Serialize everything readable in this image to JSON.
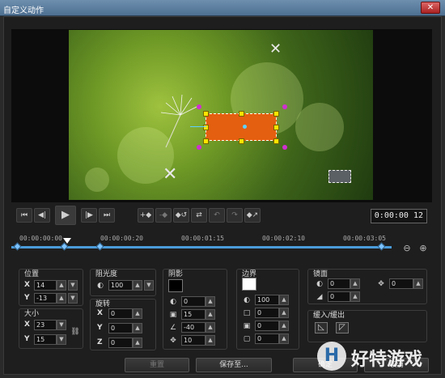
{
  "window": {
    "title": "自定义动作",
    "close_glyph": "✕"
  },
  "preview": {
    "cross_glyph": "✕",
    "icons": [
      "close-icon",
      "dandelion-icon"
    ]
  },
  "controls": {
    "buttons": [
      {
        "name": "go-start-button",
        "glyph": "⏮"
      },
      {
        "name": "prev-frame-button",
        "glyph": "◀|"
      },
      {
        "name": "play-button",
        "glyph": "▶"
      },
      {
        "name": "next-frame-button",
        "glyph": "|▶"
      },
      {
        "name": "go-end-button",
        "glyph": "⏭"
      },
      {
        "name": "add-keyframe-button",
        "glyph": "+◆"
      },
      {
        "name": "remove-keyframe-button",
        "glyph": "-◆"
      },
      {
        "name": "reverse-keyframe-button",
        "glyph": "◆↺"
      },
      {
        "name": "swap-keyframe-button",
        "glyph": "⇄"
      },
      {
        "name": "move-left-keyframe-button",
        "glyph": "↶"
      },
      {
        "name": "move-right-keyframe-button",
        "glyph": "↷"
      },
      {
        "name": "smooth-keyframe-button",
        "glyph": "◆↗"
      }
    ],
    "timecode": "0:00:00  12"
  },
  "timeline": {
    "ticks": [
      "00:00:00:00",
      "00:00:00:20",
      "00:00:01:15",
      "00:00:02:10",
      "00:00:03:05"
    ],
    "zoom_out_glyph": "⊖",
    "zoom_in_glyph": "⊕"
  },
  "position": {
    "title": "位置",
    "x_label": "X",
    "x_value": "14",
    "y_label": "Y",
    "y_value": "-13"
  },
  "size": {
    "title": "大小",
    "x_label": "X",
    "x_value": "23",
    "y_label": "Y",
    "y_value": "15",
    "link_glyph": "⛓"
  },
  "opacity": {
    "title": "阻光度",
    "value": "100"
  },
  "rotation": {
    "title": "旋转",
    "x_label": "X",
    "x_value": "0",
    "y_label": "Y",
    "y_value": "0",
    "z_label": "Z",
    "z_value": "0"
  },
  "shadow": {
    "title": "阴影",
    "color": "#000000",
    "values": [
      "0",
      "15",
      "-40",
      "10"
    ]
  },
  "border": {
    "title": "边界",
    "color": "#ffffff",
    "values": [
      "100",
      "0",
      "0",
      "0"
    ]
  },
  "mirror": {
    "title": "镜面",
    "values": [
      "0",
      "0"
    ],
    "offset_value": "0"
  },
  "fade": {
    "title": "缓入/缓出"
  },
  "footer": {
    "reset": "重置",
    "save_to": "保存至...",
    "ok": "确定",
    "cancel": "取消"
  },
  "watermark": {
    "logo": "H",
    "text": "好特游戏"
  }
}
